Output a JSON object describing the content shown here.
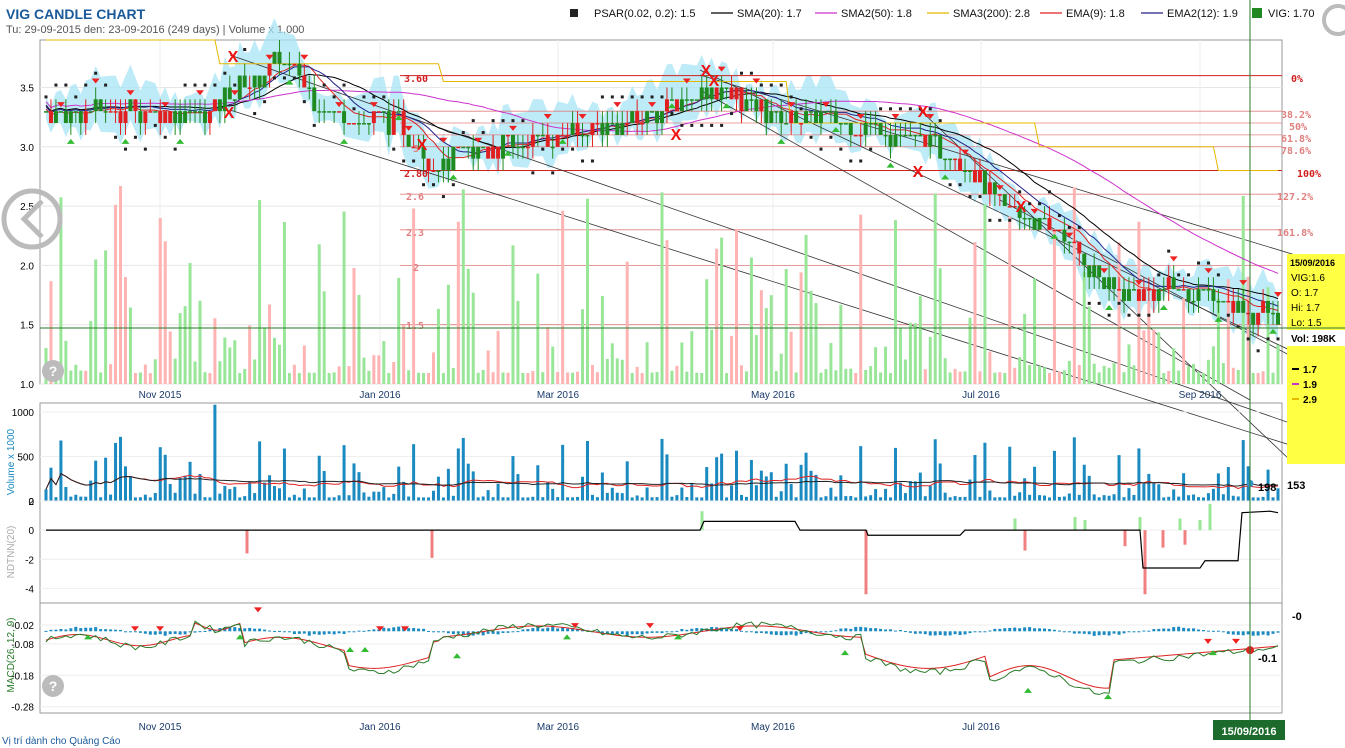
{
  "header": {
    "title": "VIG CANDLE CHART",
    "subtitle": "Tu: 29-09-2015 den: 23-09-2016 (249 days) | Volume x 1,000"
  },
  "legend": [
    {
      "label": "PSAR(0.02, 0.2): 1.5",
      "color": "#222222",
      "icon": "square-marker"
    },
    {
      "label": "SMA(20): 1.7",
      "color": "#000000",
      "icon": "line"
    },
    {
      "label": "SMA2(50): 1.8",
      "color": "#cc33cc",
      "icon": "line"
    },
    {
      "label": "SMA3(200): 2.8",
      "color": "#e6b800",
      "icon": "line"
    },
    {
      "label": "EMA(9): 1.8",
      "color": "#dd2222",
      "icon": "line"
    },
    {
      "label": "EMA2(12): 1.9",
      "color": "#222288",
      "icon": "line"
    },
    {
      "label": "VIG: 1.70",
      "color": "#228822",
      "icon": "square-marker"
    }
  ],
  "months": [
    "Nov 2015",
    "Jan 2016",
    "Mar 2016",
    "May 2016",
    "Jul 2016",
    "Sep 2016"
  ],
  "panels": {
    "volume_label": "Volume x 1000",
    "ndtnn_label": "NDTNN(20)",
    "macd_label": "MACD(26, 12, 9)"
  },
  "fibonacci": {
    "right_labels": [
      "0%",
      "38.2%",
      "50%",
      "61.8%",
      "78.6%",
      "100%",
      "127.2%",
      "161.8%"
    ],
    "left_labels": [
      "3.60",
      "3",
      "2.80",
      "2.6",
      "2.3",
      "2",
      "1.5"
    ]
  },
  "info_box": {
    "date": "15/09/2016",
    "symbol": "VIG:1.6",
    "open": "O: 1.7",
    "high": "Hi: 1.7",
    "low": "Lo: 1.5",
    "volume": "Vol: 198K",
    "ma_values": [
      "1.7",
      "1.9",
      "2.9"
    ]
  },
  "annotations": {
    "volume_last": "198",
    "volume_avg": "153",
    "macd_top": "-0",
    "macd_last": "-0.1"
  },
  "crosshair_date": "15/09/2016",
  "footer_ad": "Vị trí dành cho Quảng Cáo",
  "colors": {
    "up_candle": "#1f8a1f",
    "down_candle": "#e02020",
    "volume_up": "#99e699",
    "volume_down": "#ffb3b3",
    "volume_panel_bar": "#1a8ac0",
    "cloud": "#a8e4f5",
    "crosshair": "#2a7a2a",
    "info_box_bg": "#ffff44"
  },
  "chart_data": {
    "type": "candlestick",
    "title": "VIG CANDLE CHART",
    "x_range": [
      "2015-09-29",
      "2016-09-23"
    ],
    "price_axis": {
      "ylim": [
        1.0,
        3.9
      ],
      "ticks": [
        1.0,
        1.5,
        2.0,
        2.5,
        3.0,
        3.5
      ]
    },
    "volume_axis": {
      "label": "Volume x 1000",
      "ylim": [
        0,
        1100
      ],
      "ticks": [
        0,
        500,
        1000
      ]
    },
    "ndtnn_axis": {
      "label": "NDTNN(20)",
      "ylim": [
        -5,
        2
      ],
      "ticks": [
        2,
        0,
        -2,
        -4
      ]
    },
    "macd_axis": {
      "label": "MACD(26, 12, 9)",
      "ylim": [
        -0.3,
        0.05
      ],
      "ticks": [
        -0.02,
        -0.08,
        -0.18,
        -0.28
      ]
    },
    "price_key_points": [
      {
        "date": "2015-10-01",
        "close": 3.3
      },
      {
        "date": "2015-11-15",
        "close": 3.3
      },
      {
        "date": "2015-12-07",
        "close": 3.75
      },
      {
        "date": "2015-12-20",
        "close": 3.3
      },
      {
        "date": "2016-01-10",
        "close": 3.2
      },
      {
        "date": "2016-01-20",
        "close": 2.85
      },
      {
        "date": "2016-02-10",
        "close": 3.0
      },
      {
        "date": "2016-03-15",
        "close": 3.2
      },
      {
        "date": "2016-04-12",
        "close": 3.5
      },
      {
        "date": "2016-04-25",
        "close": 3.3
      },
      {
        "date": "2016-05-20",
        "close": 3.2
      },
      {
        "date": "2016-06-10",
        "close": 3.05
      },
      {
        "date": "2016-06-20",
        "close": 2.95
      },
      {
        "date": "2016-07-05",
        "close": 2.5
      },
      {
        "date": "2016-07-20",
        "close": 2.3
      },
      {
        "date": "2016-08-05",
        "close": 1.8
      },
      {
        "date": "2016-08-25",
        "close": 1.8
      },
      {
        "date": "2016-09-10",
        "close": 1.7
      },
      {
        "date": "2016-09-15",
        "close": 1.6
      },
      {
        "date": "2016-09-23",
        "close": 1.6
      }
    ],
    "fib_levels": [
      {
        "label": "0%",
        "price": 3.6
      },
      {
        "label": "38.2%",
        "price": 3.3
      },
      {
        "label": "50%",
        "price": 3.2
      },
      {
        "label": "61.8%",
        "price": 3.1
      },
      {
        "label": "78.6%",
        "price": 3.0
      },
      {
        "label": "100%",
        "price": 2.8
      },
      {
        "label": "127.2%",
        "price": 2.6
      },
      {
        "label": "161.8%",
        "price": 2.3
      },
      {
        "label": "",
        "price": 2.0
      },
      {
        "label": "",
        "price": 1.5
      }
    ],
    "last_values": {
      "psar": 1.5,
      "sma20": 1.7,
      "sma50": 1.8,
      "sma200": 2.8,
      "ema9": 1.8,
      "ema12": 1.9,
      "close": 1.7
    },
    "selected_bar": {
      "date": "2016-09-15",
      "open": 1.7,
      "high": 1.7,
      "low": 1.5,
      "volume_k": 198
    }
  }
}
